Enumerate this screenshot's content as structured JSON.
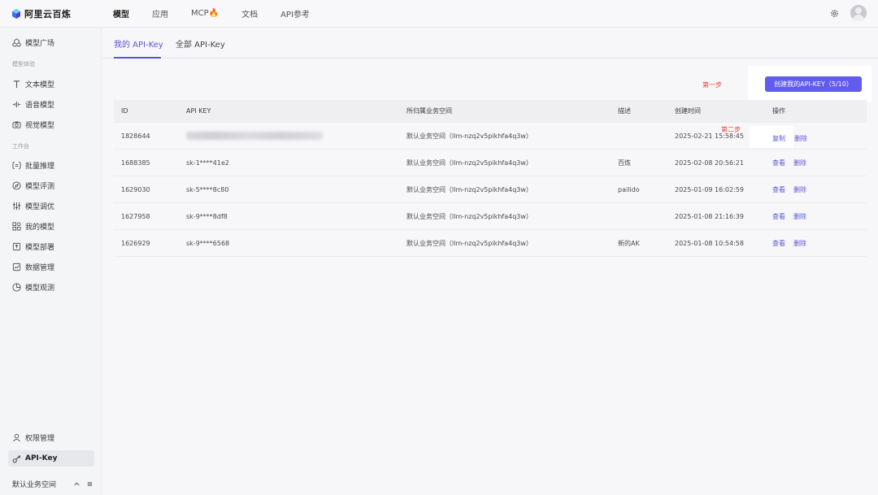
{
  "brand": {
    "name": "阿里云百炼"
  },
  "topnav": {
    "items": [
      {
        "label": "模型"
      },
      {
        "label": "应用"
      },
      {
        "label": "MCP🔥"
      },
      {
        "label": "文档"
      },
      {
        "label": "API参考"
      }
    ]
  },
  "sidebar": {
    "model_square": "模型广场",
    "group_model_experience": "模型体验",
    "text_model": "文本模型",
    "voice_model": "语音模型",
    "vision_model": "视觉模型",
    "group_workbench": "工作台",
    "batch_inference": "批量推理",
    "model_eval": "模型评测",
    "model_tuning": "模型调优",
    "my_models": "我的模型",
    "model_deploy": "模型部署",
    "data_mgmt": "数据管理",
    "model_observe": "模型观测",
    "permission_mgmt": "权限管理",
    "api_key": "API-Key",
    "workspace": "默认业务空间"
  },
  "tabs": {
    "my_api_key": "我的 API-Key",
    "all_api_key": "全部 API-Key"
  },
  "annotations": {
    "step_one": "第一步",
    "step_two": "第二步"
  },
  "create_button": "创建我的API-KEY（5/10）",
  "table": {
    "headers": {
      "id": "ID",
      "api_key": "API KEY",
      "workspace": "所归属业务空间",
      "desc": "描述",
      "created": "创建时间",
      "ops": "操作"
    },
    "rows": [
      {
        "id": "1828644",
        "key": "",
        "workspace": "默认业务空间（llm-nzq2v5pikhfa4q3w）",
        "desc": "",
        "created": "2025-02-21 15:58:45",
        "op1": "复制",
        "op2": "删除"
      },
      {
        "id": "1688385",
        "key": "sk-1****41e2",
        "workspace": "默认业务空间（llm-nzq2v5pikhfa4q3w）",
        "desc": "百炼",
        "created": "2025-02-08 20:56:21",
        "op1": "查看",
        "op2": "删除"
      },
      {
        "id": "1629030",
        "key": "sk-5****8c80",
        "workspace": "默认业务空间（llm-nzq2v5pikhfa4q3w）",
        "desc": "pailido",
        "created": "2025-01-09 16:02:59",
        "op1": "查看",
        "op2": "删除"
      },
      {
        "id": "1627958",
        "key": "sk-9****8df8",
        "workspace": "默认业务空间（llm-nzq2v5pikhfa4q3w）",
        "desc": "",
        "created": "2025-01-08 21:16:39",
        "op1": "查看",
        "op2": "删除"
      },
      {
        "id": "1626929",
        "key": "sk-9****6568",
        "workspace": "默认业务空间（llm-nzq2v5pikhfa4q3w）",
        "desc": "新的AK",
        "created": "2025-01-08 10:54:58",
        "op1": "查看",
        "op2": "删除"
      }
    ]
  },
  "colors": {
    "accent": "#615ced",
    "annotation": "#e0453a"
  }
}
